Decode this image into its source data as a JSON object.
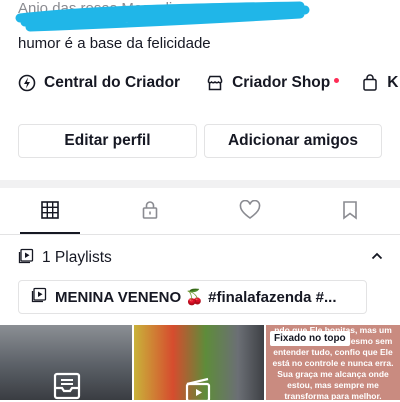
{
  "header": {
    "name_partial": "Anjo das rosas Masculin",
    "bio": "humor é a base da felicidade"
  },
  "links": [
    {
      "label": "Central do Criador",
      "icon": "lightning-bulb-icon"
    },
    {
      "label": "Criador Shop",
      "icon": "shop-icon",
      "has_dot": true
    },
    {
      "label": "K",
      "icon": "shopping-bag-icon"
    }
  ],
  "buttons": {
    "edit_profile": "Editar perfil",
    "add_friends": "Adicionar amigos"
  },
  "tabs": [
    {
      "name": "videos",
      "icon": "grid-icon",
      "active": true
    },
    {
      "name": "private",
      "icon": "lock-icon",
      "active": false
    },
    {
      "name": "liked",
      "icon": "heart-icon",
      "active": false
    },
    {
      "name": "favorites",
      "icon": "bookmark-icon",
      "active": false
    }
  ],
  "playlists": {
    "header": "1 Playlists",
    "item": "MENINA VENENO 🍒 #finalafazenda #..."
  },
  "thumbnails": {
    "pinned_label": "Fixado no topo",
    "overlay_text": "ndo que Ele bonitas, mas um coração sincero. Mesmo sem entender tudo, confio que Ele está no controle e nunca erra. Sua graça me alcança onde estou, mas sempre me transforma para melhor."
  },
  "colors": {
    "accent": "#fe2c55",
    "text": "#161823",
    "border": "#e3e3e4",
    "scribble": "#20b6e8"
  }
}
